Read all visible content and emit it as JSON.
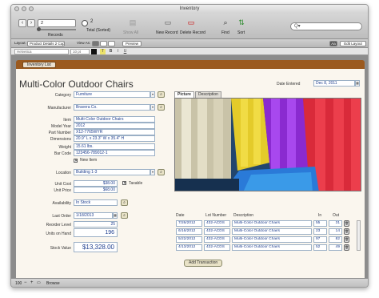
{
  "window": {
    "title": "Inventory"
  },
  "toolbar": {
    "record_current": "2",
    "records_label": "Records",
    "total_text": "2",
    "total_caption": "Total (Sorted)",
    "show_all": "Show All",
    "new_record": "New Record",
    "delete_record": "Delete Record",
    "find": "Find",
    "sort": "Sort",
    "search_placeholder": "Q▾"
  },
  "layoutbar": {
    "layout_label": "Layout:",
    "layout_value": "Product Details 2 Copy",
    "view_as_label": "View As:",
    "preview": "Preview",
    "aa": "Aa",
    "edit_layout": "Edit Layout"
  },
  "formatbar": {
    "font": "Helvetica",
    "size": "10 pt",
    "bold": "B",
    "italic": "I",
    "underline": "U"
  },
  "header": {
    "tab_label": "Inventory List"
  },
  "form": {
    "title": "Multi-Color Outdoor Chairs",
    "date_entered_label": "Date Entered",
    "date_entered": "Dec 8, 2011",
    "category_label": "Category",
    "category": "Furniture",
    "manufacturer_label": "Manufacturer",
    "manufacturer": "Bravera Co.",
    "item_label": "Item",
    "item": "Multi-Color Outdoor Chairs",
    "model_year_label": "Model Year",
    "model_year": "2012",
    "part_number_label": "Part Number",
    "part_number": "X12-7765WYR",
    "dimensions_label": "Dimensions",
    "dimensions": "20.9\" L x 23.3\" W x 35.4\" H",
    "weight_label": "Weight",
    "weight": "15.61 lbs.",
    "bar_code_label": "Bar Code",
    "bar_code": "123456-789012-1",
    "new_item_label": "New Item",
    "location_label": "Location",
    "location": "Building 1-3",
    "unit_cost_label": "Unit Cost",
    "unit_cost": "$38.00",
    "taxable_label": "Taxable",
    "unit_price_label": "Unit Price",
    "unit_price": "$68.00",
    "availability_label": "Availability",
    "availability": "In Stock",
    "last_order_label": "Last Order",
    "last_order": "1/18/2013",
    "reorder_level_label": "Reorder Level",
    "reorder_level": "25",
    "units_on_hand_label": "Units on Hand",
    "units_on_hand": "196",
    "stock_value_label": "Stock Value",
    "stock_value": "$13,328.00"
  },
  "panel": {
    "tabs": [
      {
        "label": "Picture"
      },
      {
        "label": "Description"
      }
    ]
  },
  "transactions": {
    "headers": {
      "date": "Date",
      "lot": "Lot Number",
      "desc": "Description",
      "in": "In",
      "out": "Out"
    },
    "rows": [
      {
        "date": "7/26/2012",
        "lot": "432-ACDS",
        "desc": "Multi-Color Outdoor Chairs",
        "in": "55",
        "out": "31"
      },
      {
        "date": "6/16/2012",
        "lot": "432-ACDS",
        "desc": "Multi-Color Outdoor Chairs",
        "in": "23",
        "out": "14"
      },
      {
        "date": "5/22/2012",
        "lot": "432-ACDS",
        "desc": "Multi-Color Outdoor Chairs",
        "in": "97",
        "out": "82"
      },
      {
        "date": "4/13/2012",
        "lot": "432-ACDS",
        "desc": "Multi-Color Outdoor Chairs",
        "in": "52",
        "out": "49"
      }
    ],
    "add_button": "Add Transaction"
  },
  "status": {
    "zoom": "100",
    "mode": "Browse"
  }
}
